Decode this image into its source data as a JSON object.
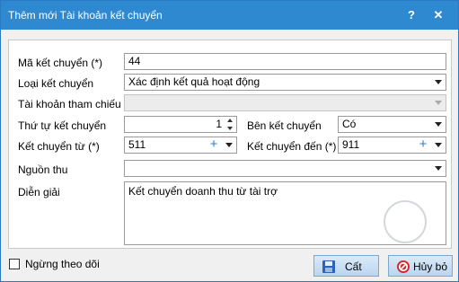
{
  "window": {
    "title": "Thêm mới Tài khoản kết chuyển",
    "help_glyph": "?",
    "close_glyph": "✕"
  },
  "form": {
    "ma_ket_chuyen": {
      "label": "Mã kết chuyển (*)",
      "value": "44"
    },
    "loai_ket_chuyen": {
      "label": "Loại kết chuyển",
      "value": "Xác định kết quả hoạt động"
    },
    "tai_khoan_tham_chieu": {
      "label": "Tài khoản tham chiếu",
      "value": ""
    },
    "thu_tu_ket_chuyen": {
      "label": "Thứ tự kết chuyển",
      "value": "1"
    },
    "ben_ket_chuyen": {
      "label": "Bên kết chuyển",
      "value": "Có"
    },
    "ket_chuyen_tu": {
      "label": "Kết chuyển từ (*)",
      "value": "511"
    },
    "ket_chuyen_den": {
      "label": "Kết chuyển đến (*)",
      "value": "911"
    },
    "nguon_thu": {
      "label": "Nguồn thu",
      "value": ""
    },
    "dien_giai": {
      "label": "Diễn giải",
      "value": "Kết chuyển doanh thu từ tài trợ"
    },
    "plus_glyph": "+"
  },
  "footer": {
    "ngung_theo_doi_label": "Ngừng theo dõi",
    "ngung_theo_doi_checked": false,
    "save_label": "Cất",
    "cancel_label": "Hủy bỏ"
  },
  "icons": {
    "save": "floppy-disk-icon",
    "cancel": "cancel-circle-icon",
    "dropdown": "chevron-down-icon",
    "add": "plus-icon",
    "spinner": "spin-arrows-icon"
  },
  "colors": {
    "titlebar": "#2f89d0",
    "plus": "#2b7fd3",
    "cancel_icon": "#d9262b",
    "save_icon": "#2b63b8"
  }
}
